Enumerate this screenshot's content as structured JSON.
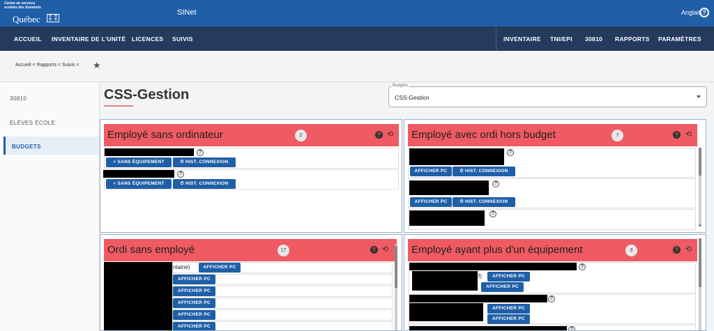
{
  "topbar": {
    "logo_small": "Centre de services scolaire des Sommets",
    "logo_big": "Québec",
    "app_name": "SINet",
    "language": "Anglais",
    "help_glyph": "?"
  },
  "nav": {
    "left": [
      "ACCUEIL",
      "INVENTAIRE DE L'UNITÉ",
      "LICENCES",
      "SUIVIS"
    ],
    "right": [
      "INVENTAIRE",
      "TNI/EPI",
      "30810",
      "RAPPORTS",
      "PARAMÈTRES"
    ]
  },
  "breadcrumb": "Accueil  <  Rapports  <  Suivis  <",
  "star_glyph": "★",
  "sidebar": [
    "30810",
    "ÉLÈVES ÉCOLE",
    "BUDGETS"
  ],
  "page_title": "CSS-Gestion",
  "budget": {
    "label": "Budgets",
    "value": "CSS-Gestion"
  },
  "panels": {
    "p1": {
      "title": "Employé sans ordinateur",
      "count": "2"
    },
    "p2": {
      "title": "Employé avec ordi hors budget",
      "count": "7"
    },
    "p3": {
      "title": "Ordi sans employé",
      "count": "17"
    },
    "p4": {
      "title": "Employé ayant plus d'un équipement",
      "count": "3"
    }
  },
  "buttons": {
    "sans_equipement": "SANS ÉQUIPEMENT",
    "hist_connexion": "HIST. CONNEXION",
    "afficher_pc": "AFFICHER PC"
  },
  "row_texts": {
    "p3_first": "ntaine)",
    "p4_first": "f)"
  },
  "icons": {
    "plus": "+",
    "clock": "⏱",
    "sync": "⟲",
    "help": "?"
  }
}
